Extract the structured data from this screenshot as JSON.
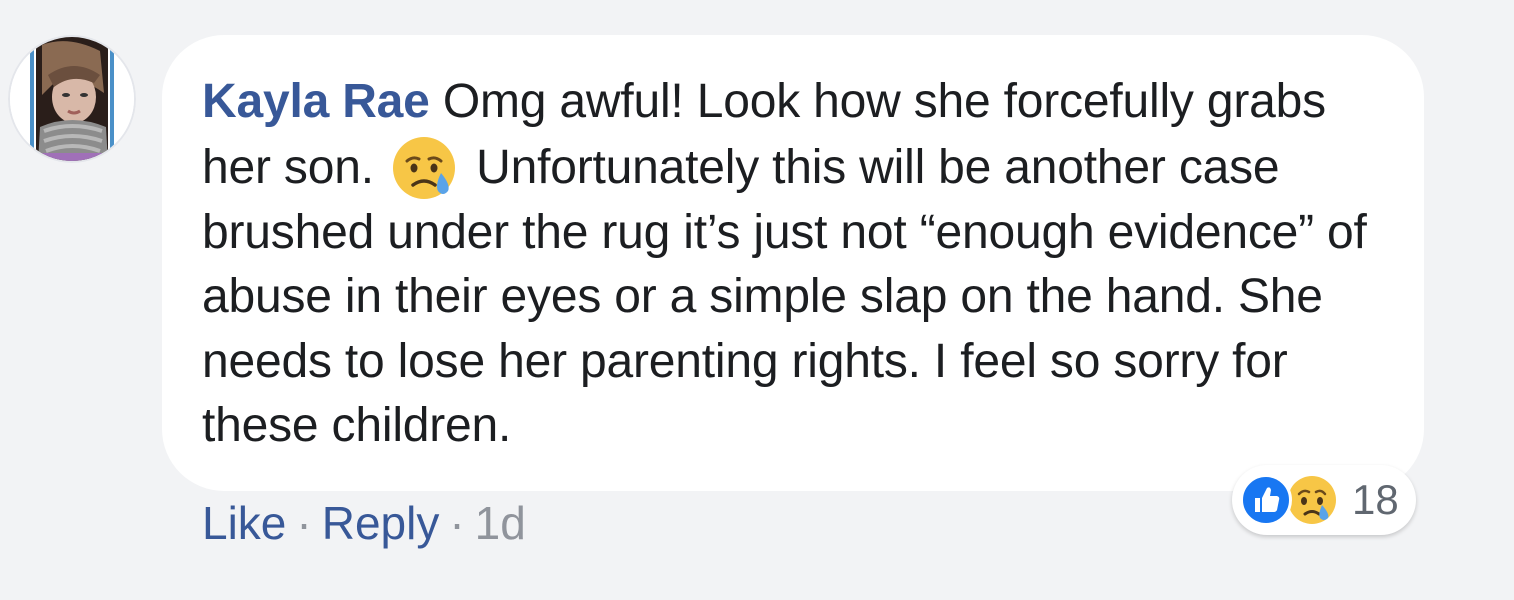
{
  "comment": {
    "author": "Kayla Rae",
    "text_part1": "Omg awful! Look how she forcefully grabs her son.",
    "inline_emoji": "crying-face-icon",
    "text_part2": "Unfortunately this will be another case brushed under the rug it’s just not “enough evidence” of abuse in their eyes or a simple slap on the hand. She needs to lose her parenting rights. I feel so sorry for these children."
  },
  "actions": {
    "like_label": "Like",
    "separator": "·",
    "reply_label": "Reply",
    "timestamp": "1d"
  },
  "reactions": {
    "icons": [
      "like-icon",
      "sad-icon"
    ],
    "count": "18"
  },
  "colors": {
    "page_background": "#f2f3f5",
    "bubble_background": "#ffffff",
    "author_link": "#385898",
    "body_text": "#1c1e21",
    "meta_text": "#90949c",
    "like_blue": "#1877f2",
    "emoji_yellow": "#f7c646"
  }
}
